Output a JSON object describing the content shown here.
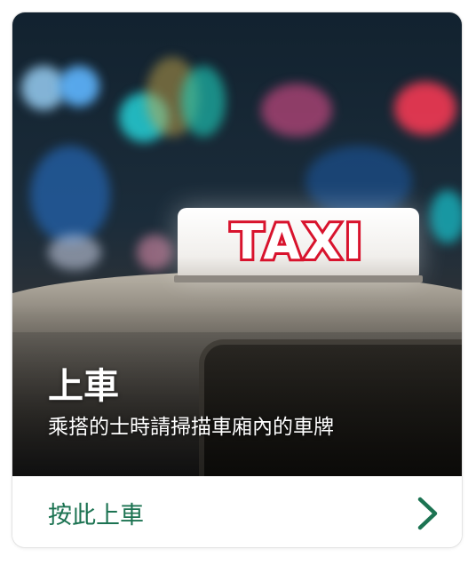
{
  "hero": {
    "sign_text": "TAXI",
    "title": "上車",
    "subtitle": "乘搭的士時請掃描車廂內的車牌"
  },
  "action": {
    "label": "按此上車",
    "icon": "chevron-right-icon"
  },
  "colors": {
    "accent": "#1c7352",
    "sign_red": "#d8132d"
  }
}
